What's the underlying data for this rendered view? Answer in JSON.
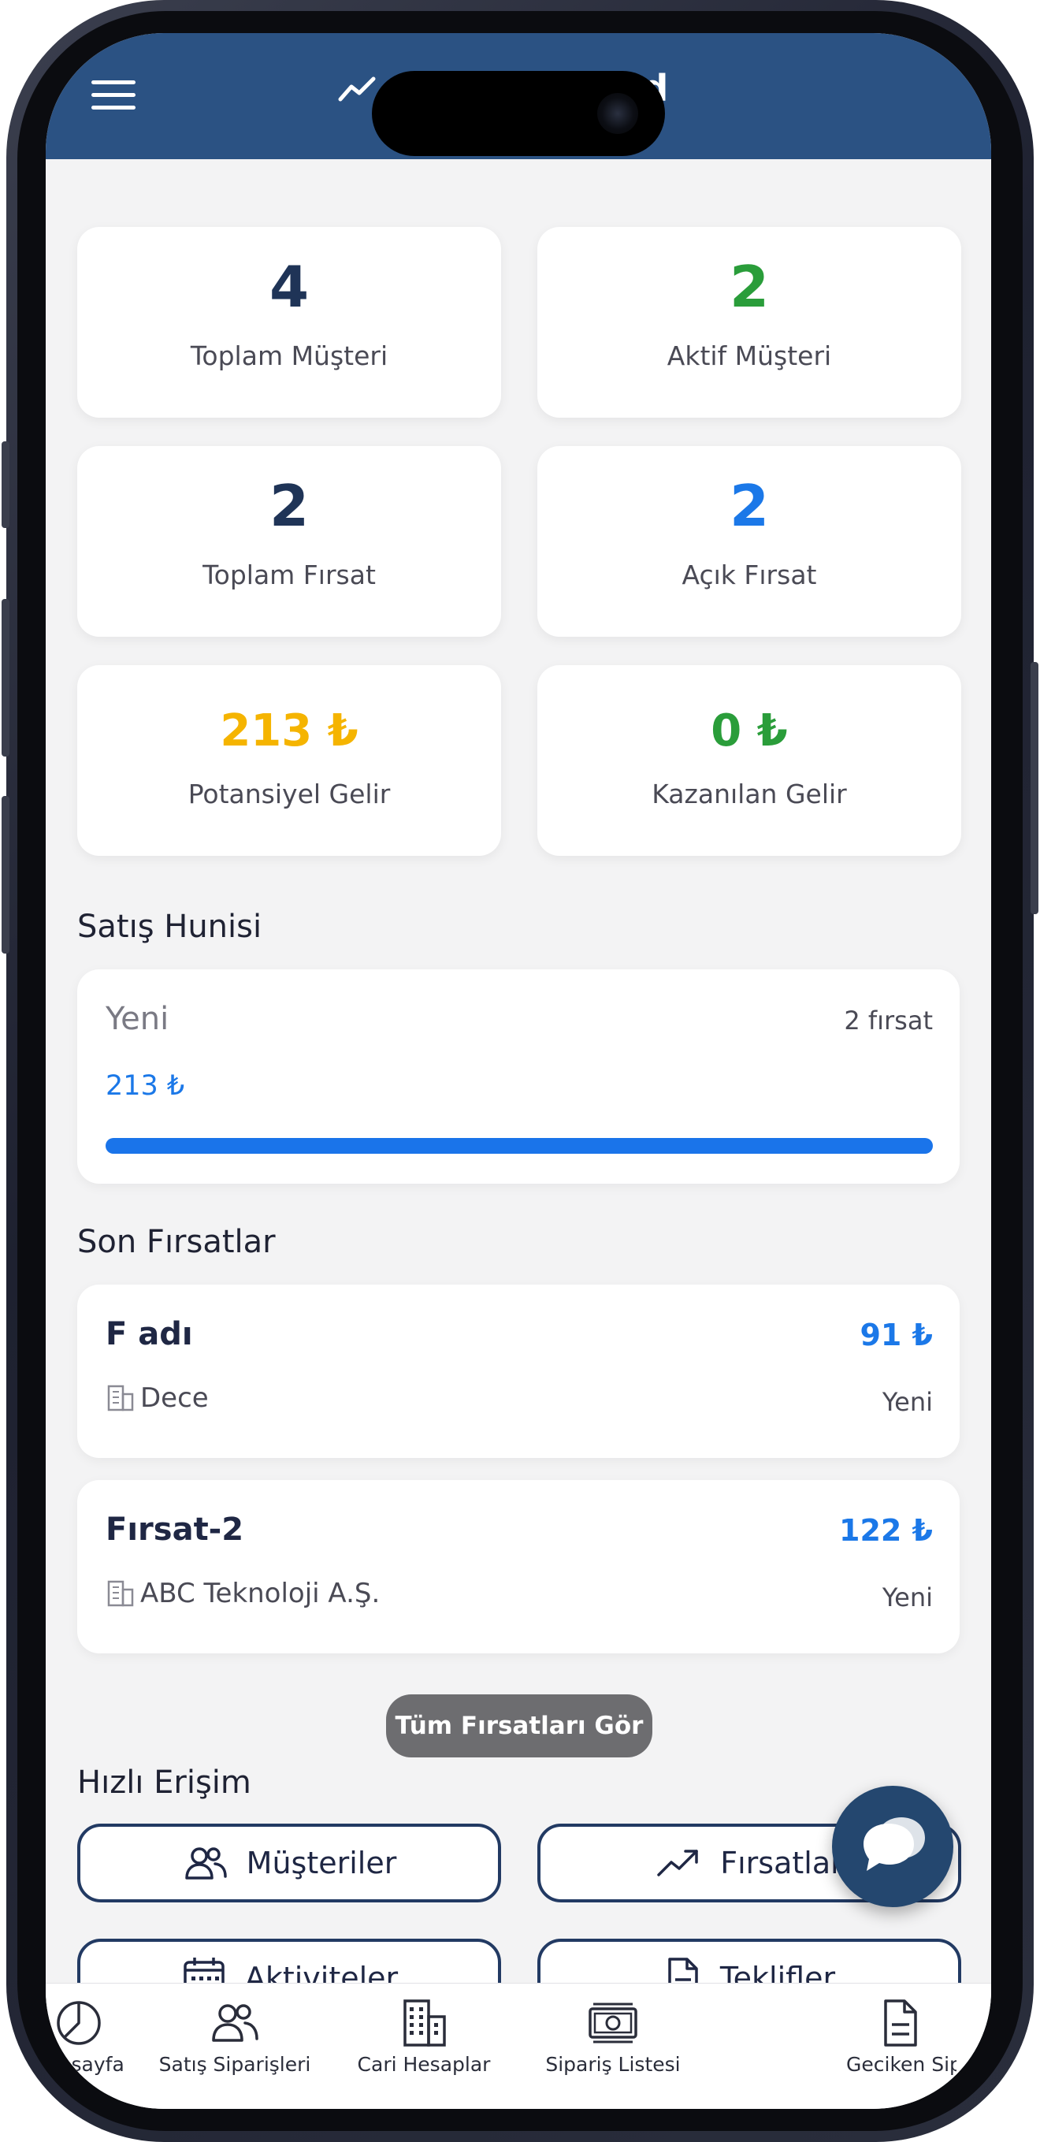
{
  "header": {
    "title": "Dashboard",
    "title_icon": "trending-up-icon",
    "menu_icon": "hamburger-menu-icon",
    "bar_color": "#2b5283"
  },
  "stats": [
    {
      "value": "4",
      "label": "Toplam Müşteri",
      "color": "#1f3457"
    },
    {
      "value": "2",
      "label": "Aktif Müşteri",
      "color": "#2a9d3a"
    },
    {
      "value": "2",
      "label": "Toplam Fırsat",
      "color": "#1f3457"
    },
    {
      "value": "2",
      "label": "Açık Fırsat",
      "color": "#1b78e8"
    },
    {
      "value": "213 ₺",
      "label": "Potansiyel Gelir",
      "color": "#f5b400"
    },
    {
      "value": "0 ₺",
      "label": "Kazanılan Gelir",
      "color": "#2a9d3a"
    }
  ],
  "sales_funnel": {
    "title": "Satış Hunisi",
    "stage": "Yeni",
    "count": "2 fırsat",
    "amount": "213 ₺",
    "progress_percent": 100,
    "bar_color": "#1a74ea"
  },
  "recent_opportunities": {
    "title": "Son Fırsatlar",
    "items": [
      {
        "name": "F adı",
        "amount": "91 ₺",
        "account": "Dece",
        "stage": "Yeni"
      },
      {
        "name": "Fırsat-2",
        "amount": "122 ₺",
        "account": "ABC Teknoloji A.Ş.",
        "stage": "Yeni"
      }
    ],
    "see_all_label": "Tüm Fırsatları Gör"
  },
  "quick_access": {
    "title": "Hızlı Erişim",
    "items": [
      {
        "label": "Müşteriler",
        "icon": "users-icon"
      },
      {
        "label": "Fırsatlar",
        "icon": "trending-up-icon"
      },
      {
        "label": "Aktiviteler",
        "icon": "calendar-icon"
      },
      {
        "label": "Teklifler",
        "icon": "document-icon"
      }
    ]
  },
  "fab": {
    "icon": "chat-icon"
  },
  "bottom_nav": [
    {
      "label": "Anasayfa",
      "icon": "pie-chart-icon"
    },
    {
      "label": "Satış Siparişleri",
      "icon": "users-icon"
    },
    {
      "label": "Cari Hesaplar",
      "icon": "building-icon"
    },
    {
      "label": "Sipariş Listesi",
      "icon": "money-icon"
    },
    {
      "label": "Geciken Siparişler",
      "icon": "document-icon"
    }
  ]
}
